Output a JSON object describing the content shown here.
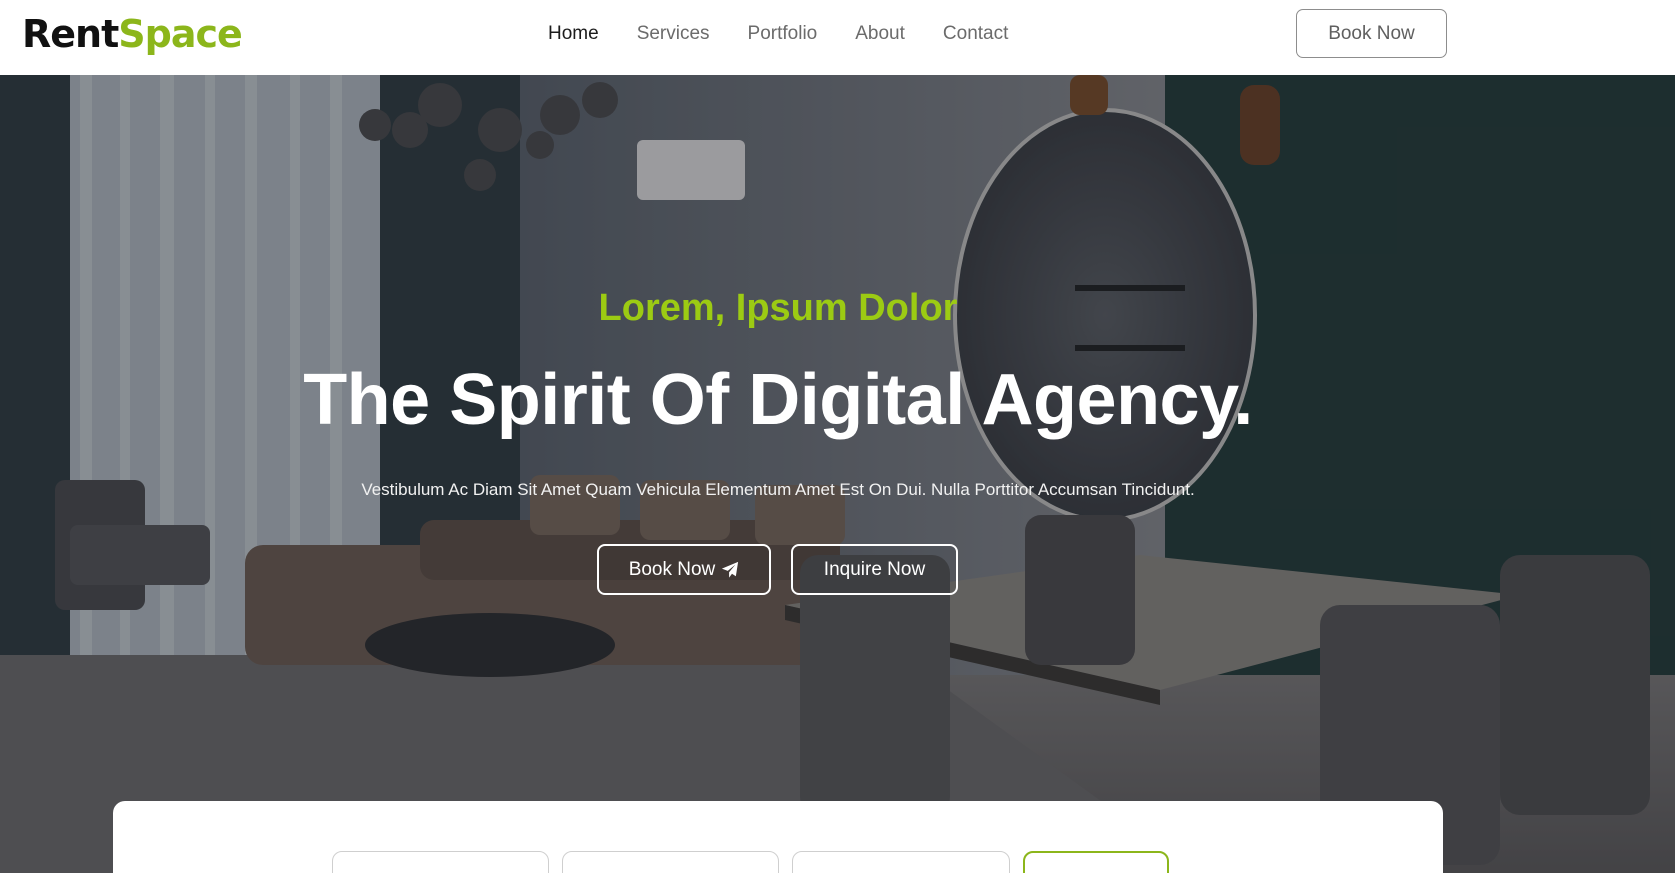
{
  "brand": {
    "part1": "Rent",
    "part2": "Space",
    "accent": "#8cb61b"
  },
  "nav": {
    "items": [
      {
        "label": "Home",
        "active": true
      },
      {
        "label": "Services",
        "active": false
      },
      {
        "label": "Portfolio",
        "active": false
      },
      {
        "label": "About",
        "active": false
      },
      {
        "label": "Contact",
        "active": false
      }
    ],
    "cta": "Book Now"
  },
  "hero": {
    "eyebrow": "Lorem, Ipsum Dolor",
    "title": "The Spirit Of Digital Agency.",
    "subtitle": "Vestibulum Ac Diam Sit Amet Quam Vehicula Elementum Amet Est On Dui. Nulla Porttitor Accumsan Tincidunt.",
    "primary_button": "Book Now",
    "primary_icon": "paper-plane-icon",
    "secondary_button": "Inquire Now",
    "eyebrow_color": "#9ccb13"
  },
  "booking": {
    "fields": [
      "",
      "",
      ""
    ],
    "submit": ""
  }
}
